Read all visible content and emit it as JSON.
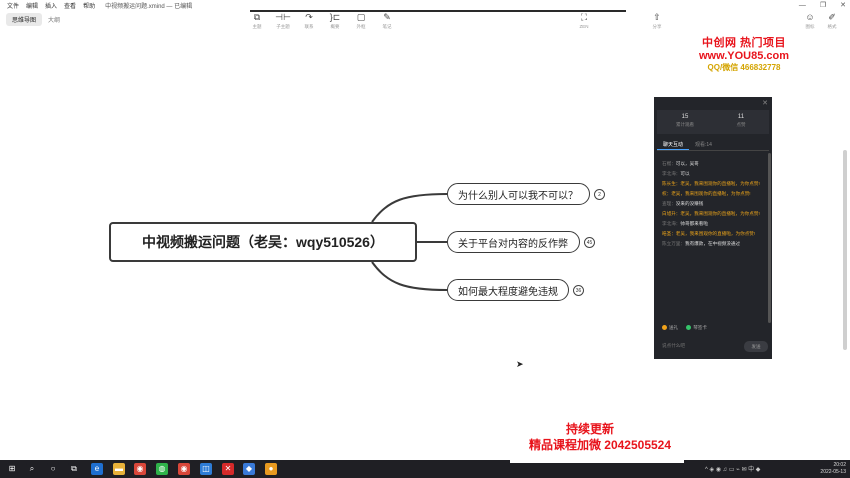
{
  "menubar": {
    "items": [
      "文件",
      "编辑",
      "插入",
      "查看",
      "帮助"
    ],
    "doc_title": "中视频搬运问题.xmind — 已编辑"
  },
  "window_controls": {
    "minimize": "—",
    "restore": "❐",
    "close": "✕"
  },
  "view_switch": {
    "mindmap": "思维导图",
    "outline": "大纲"
  },
  "toolbar": {
    "tools": [
      {
        "icon": "topic-icon",
        "glyph": "⧉",
        "label": "主题"
      },
      {
        "icon": "subtopic-icon",
        "glyph": "⊣⊢",
        "label": "子主题"
      },
      {
        "icon": "relationship-icon",
        "glyph": "↷",
        "label": "联系"
      },
      {
        "icon": "summary-icon",
        "glyph": "}⊏",
        "label": "概要"
      },
      {
        "icon": "boundary-icon",
        "glyph": "▢",
        "label": "外框"
      },
      {
        "icon": "note-icon",
        "glyph": "✎",
        "label": "笔记"
      }
    ],
    "zen": {
      "glyph": "⛶",
      "label": "ZEN"
    },
    "share": {
      "glyph": "⇧",
      "label": "分享"
    },
    "icons_right": [
      {
        "icon": "icon-panel-icon",
        "glyph": "☺",
        "label": "图标"
      },
      {
        "icon": "format-icon",
        "glyph": "✐",
        "label": "格式"
      }
    ]
  },
  "watermark": {
    "line1": "中创网 热门项目",
    "line2": "www.YOU85.com",
    "line3": "QQ/微信 466832778"
  },
  "mindmap": {
    "central": "中视频搬运问题（老吴：wqy510526）",
    "branches": [
      {
        "label": "为什么别人可以我不可以？",
        "badge": "2"
      },
      {
        "label": "关于平台对内容的反作弊",
        "badge": "45"
      },
      {
        "label": "如何最大程度避免违规",
        "badge": "36"
      }
    ]
  },
  "chat_panel": {
    "close": "✕",
    "stats": [
      {
        "value": "15",
        "label": "累计观看"
      },
      {
        "value": "11",
        "label": "点赞"
      }
    ],
    "tabs": {
      "active": "聊天互动",
      "inactive": "观看:14"
    },
    "messages": [
      {
        "name": "石榴：",
        "text": "可以，吴哥",
        "highlight": false
      },
      {
        "name": "李北海：",
        "text": "可以",
        "highlight": false
      },
      {
        "name": "陈长生：",
        "text": "老吴，我来围观你的直播啦，为你点赞!",
        "highlight": true
      },
      {
        "name": "权：",
        "text": "老吴，我来围观你的直播啦，为你点赞!",
        "highlight": true
      },
      {
        "name": "查理：",
        "text": "没来的没赚钱",
        "highlight": false
      },
      {
        "name": "白旭升：",
        "text": "老吴，我来围观你的直播啦，为你点赞!",
        "highlight": true
      },
      {
        "name": "李北海：",
        "text": "帅哥都来看啦",
        "highlight": false
      },
      {
        "name": "皓圣：",
        "text": "老吴，我来围观你的直播啦，为你点赞!",
        "highlight": true
      },
      {
        "name": "陈立万里：",
        "text": "我有爆款，在中视频没通过",
        "highlight": false
      }
    ],
    "gifts": [
      {
        "label": "送礼",
        "color": "#f0a21a"
      },
      {
        "label": "琴签卡",
        "color": "#35c46a"
      }
    ],
    "input_placeholder": "说点什么吧",
    "send_label": "发送"
  },
  "promo": {
    "line1": "持续更新",
    "line2": "精品课程加微 2042505524"
  },
  "taskbar": {
    "apps": [
      {
        "icon": "windows-start-icon",
        "glyph": "⊞",
        "color": "#1f1f24"
      },
      {
        "icon": "search-icon",
        "glyph": "⌕",
        "color": "#1f1f24"
      },
      {
        "icon": "cortana-icon",
        "glyph": "○",
        "color": "#1f1f24"
      },
      {
        "icon": "task-view-icon",
        "glyph": "⧉",
        "color": "#1f1f24"
      },
      {
        "icon": "edge-icon",
        "glyph": "e",
        "color": "#1f6fd0"
      },
      {
        "icon": "file-explorer-icon",
        "glyph": "▬",
        "color": "#e8b23a"
      },
      {
        "icon": "chrome-icon",
        "glyph": "◉",
        "color": "#d9473a"
      },
      {
        "icon": "wechat-icon",
        "glyph": "◍",
        "color": "#2fb34a"
      },
      {
        "icon": "chrome2-icon",
        "glyph": "◉",
        "color": "#d9473a"
      },
      {
        "icon": "media-icon",
        "glyph": "◫",
        "color": "#2e7cd6"
      },
      {
        "icon": "xmind-icon",
        "glyph": "✕",
        "color": "#d62a2a"
      },
      {
        "icon": "live-icon",
        "glyph": "◆",
        "color": "#3a7ad8"
      },
      {
        "icon": "app-orange-icon",
        "glyph": "●",
        "color": "#e89a20"
      }
    ],
    "tray_glyphs": "^ ◈ ◉ ♫ ▭ ⌁ ✉ 中 ◆",
    "time": "20:02",
    "date": "2022-05-13"
  }
}
